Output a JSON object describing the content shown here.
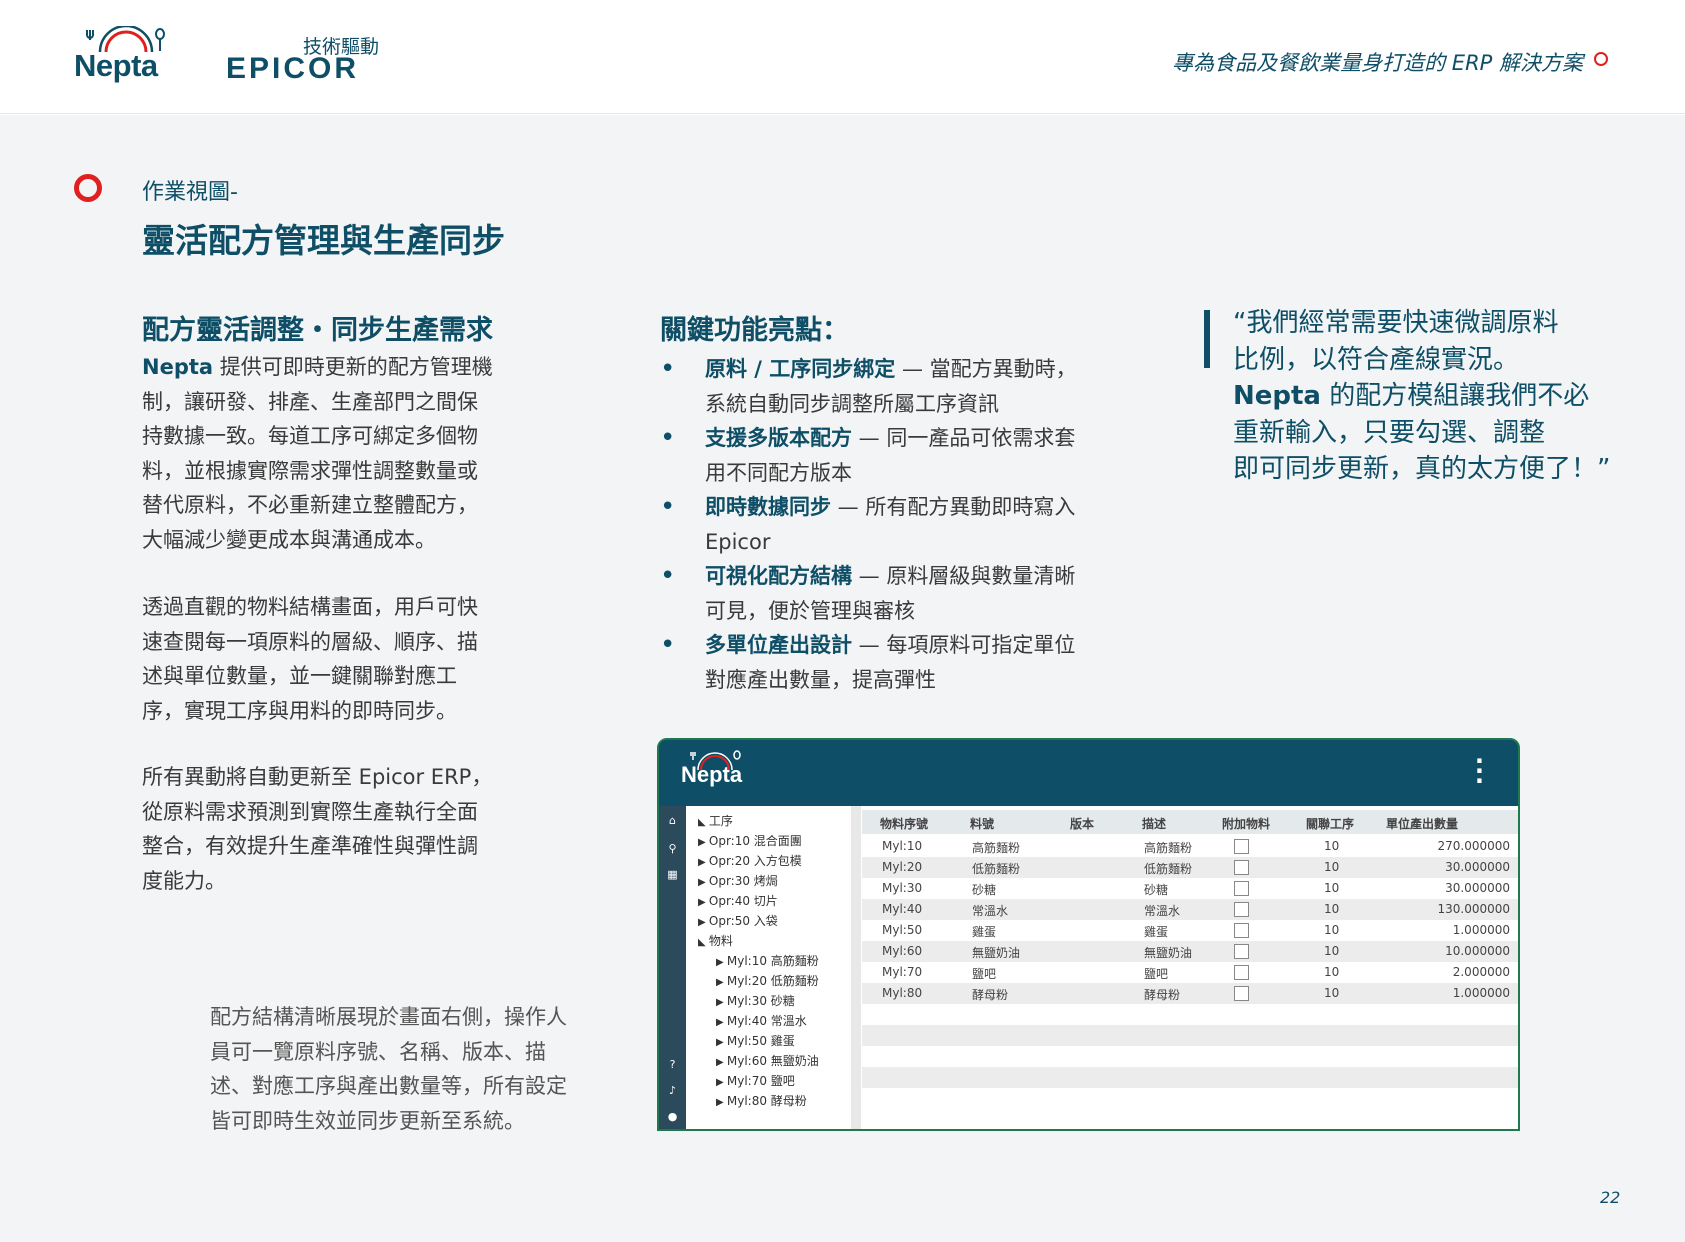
{
  "header": {
    "brand": "Nepta",
    "partner_prefix": "技術驅動",
    "partner": "EPICOR",
    "tagline": "專為食品及餐飲業量身打造的 ERP 解決方案"
  },
  "page": {
    "subtitle": "作業視圖-",
    "title": "靈活配方管理與生產同步",
    "page_number": "22"
  },
  "left": {
    "heading": "配方靈活調整・同步生產需求",
    "p1_lead": "Nepta",
    "p1_lines": [
      " 提供可即時更新的配方管理機",
      "制，讓研發、排產、生產部門之間保",
      "持數據一致。每道工序可綁定多個物",
      "料，並根據實際需求彈性調整數量或",
      "替代原料，不必重新建立整體配方，",
      "大幅減少變更成本與溝通成本。"
    ],
    "p2_lines": [
      "透過直觀的物料結構畫面，用戶可快",
      "速查閱每一項原料的層級、順序、描",
      "述與單位數量，並一鍵關聯對應工",
      "序，實現工序與用料的即時同步。"
    ],
    "p3_lines": [
      "所有異動將自動更新至 Epicor ERP，",
      "從原料需求預測到實際生產執行全面",
      "整合，有效提升生產準確性與彈性調",
      "度能力。"
    ],
    "caption_lines": [
      "配方結構清晰展現於畫面右側，操作人",
      "員可一覽原料序號、名稱、版本、描",
      "述、對應工序與產出數量等，所有設定",
      "皆可即時生效並同步更新至系統。"
    ]
  },
  "features": {
    "heading": "關鍵功能亮點：",
    "items": [
      {
        "bold": "原料 / 工序同步綁定",
        "text": " — 當配方異動時，",
        "text2": "系統自動同步調整所屬工序資訊"
      },
      {
        "bold": "支援多版本配方",
        "text": " — 同一產品可依需求套",
        "text2": "用不同配方版本"
      },
      {
        "bold": "即時數據同步",
        "text": " — 所有配方異動即時寫入",
        "text2": "Epicor"
      },
      {
        "bold": "可視化配方結構",
        "text": " — 原料層級與數量清晰",
        "text2": "可見，便於管理與審核"
      },
      {
        "bold": "多單位產出設計",
        "text": " — 每項原料可指定單位",
        "text2": "對應產出數量，提高彈性"
      }
    ]
  },
  "quote": {
    "line1": "“我們經常需要快速微調原料",
    "line2": "比例，以符合產線實況。",
    "line3_bold": "Nepta",
    "line3_rest": " 的配方模組讓我們不必",
    "line4": "重新輸入，只要勾選、調整",
    "line5": "即可同步更新，真的太方便了！”"
  },
  "app": {
    "logo": "Nepta",
    "tree": {
      "process_group": "工序",
      "processes": [
        "Opr:10 混合面團",
        "Opr:20 入方包模",
        "Opr:30 烤焗",
        "Opr:40 切片",
        "Opr:50 入袋"
      ],
      "material_group": "物料",
      "materials": [
        "Myl:10 高筋麵粉",
        "Myl:20 低筋麵粉",
        "Myl:30 砂糖",
        "Myl:40 常溫水",
        "Myl:50 雞蛋",
        "Myl:60 無鹽奶油",
        "Myl:70 鹽吧",
        "Myl:80 酵母粉"
      ]
    },
    "columns": [
      "物料序號",
      "料號",
      "版本",
      "描述",
      "附加物料",
      "關聯工序",
      "單位產出數量"
    ],
    "rows": [
      {
        "seq": "Myl:10",
        "part": "高筋麵粉",
        "rev": "",
        "desc": "高筋麵粉",
        "opr": "10",
        "qty": "270.000000"
      },
      {
        "seq": "Myl:20",
        "part": "低筋麵粉",
        "rev": "",
        "desc": "低筋麵粉",
        "opr": "10",
        "qty": "30.000000"
      },
      {
        "seq": "Myl:30",
        "part": "砂糖",
        "rev": "",
        "desc": "砂糖",
        "opr": "10",
        "qty": "30.000000"
      },
      {
        "seq": "Myl:40",
        "part": "常溫水",
        "rev": "",
        "desc": "常溫水",
        "opr": "10",
        "qty": "130.000000"
      },
      {
        "seq": "Myl:50",
        "part": "雞蛋",
        "rev": "",
        "desc": "雞蛋",
        "opr": "10",
        "qty": "1.000000"
      },
      {
        "seq": "Myl:60",
        "part": "無鹽奶油",
        "rev": "",
        "desc": "無鹽奶油",
        "opr": "10",
        "qty": "10.000000"
      },
      {
        "seq": "Myl:70",
        "part": "鹽吧",
        "rev": "",
        "desc": "鹽吧",
        "opr": "10",
        "qty": "2.000000"
      },
      {
        "seq": "Myl:80",
        "part": "酵母粉",
        "rev": "",
        "desc": "酵母粉",
        "opr": "10",
        "qty": "1.000000"
      }
    ]
  },
  "colors": {
    "brand": "#0e4e66",
    "accent": "#e02020",
    "background": "#f2f4f5"
  }
}
